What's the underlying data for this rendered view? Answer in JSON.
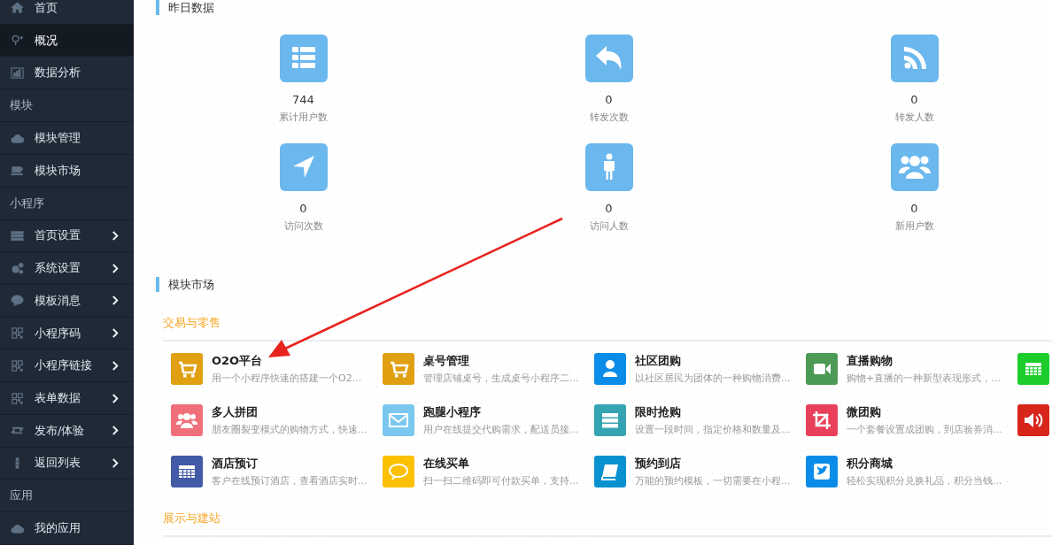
{
  "sidebar": {
    "items": [
      {
        "kind": "item",
        "label": "首页",
        "selected": false,
        "has_submenu": false
      },
      {
        "kind": "item",
        "label": "概况",
        "selected": true,
        "has_submenu": false
      },
      {
        "kind": "item",
        "label": "数据分析",
        "selected": false,
        "has_submenu": false
      },
      {
        "kind": "header",
        "label": "模块"
      },
      {
        "kind": "item",
        "label": "模块管理",
        "selected": false,
        "has_submenu": false
      },
      {
        "kind": "item",
        "label": "模块市场",
        "selected": false,
        "has_submenu": false
      },
      {
        "kind": "header",
        "label": "小程序"
      },
      {
        "kind": "item",
        "label": "首页设置",
        "selected": false,
        "has_submenu": true
      },
      {
        "kind": "item",
        "label": "系统设置",
        "selected": false,
        "has_submenu": true
      },
      {
        "kind": "item",
        "label": "模板消息",
        "selected": false,
        "has_submenu": true
      },
      {
        "kind": "item",
        "label": "小程序码",
        "selected": false,
        "has_submenu": true
      },
      {
        "kind": "item",
        "label": "小程序链接",
        "selected": false,
        "has_submenu": true
      },
      {
        "kind": "item",
        "label": "表单数据",
        "selected": false,
        "has_submenu": true
      },
      {
        "kind": "item",
        "label": "发布/体验",
        "selected": false,
        "has_submenu": true
      },
      {
        "kind": "item",
        "label": "返回列表",
        "selected": false,
        "has_submenu": true
      },
      {
        "kind": "header",
        "label": "应用"
      },
      {
        "kind": "item",
        "label": "我的应用",
        "selected": false,
        "has_submenu": false
      }
    ]
  },
  "stats_section": {
    "title": "昨日数据",
    "stats": [
      {
        "value": "744",
        "label": "累计用户数"
      },
      {
        "value": "0",
        "label": "转发次数"
      },
      {
        "value": "0",
        "label": "转发人数"
      },
      {
        "value": "0",
        "label": "访问次数"
      },
      {
        "value": "0",
        "label": "访问人数"
      },
      {
        "value": "0",
        "label": "新用户数"
      }
    ]
  },
  "market_section": {
    "title": "模块市场",
    "categories": [
      {
        "title": "交易与零售",
        "modules": [
          {
            "name": "O2O平台",
            "description": "用一个小程序快速的搭建一个O2...",
            "color": "#e0a012"
          },
          {
            "name": "桌号管理",
            "description": "管理店铺桌号，生成桌号小程序二...",
            "color": "#e0a012"
          },
          {
            "name": "社区团购",
            "description": "以社区居民为团体的一种购物消费...",
            "color": "#0a8ce8"
          },
          {
            "name": "直播购物",
            "description": "购物+直播的一种新型表现形式，...",
            "color": "#4c9a55"
          },
          {
            "color": "#1ccd2b"
          },
          {
            "name": "多人拼团",
            "description": "朋友圈裂变模式的购物方式，快速...",
            "color": "#f0707a"
          },
          {
            "name": "跑腿小程序",
            "description": "用户在线提交代购需求，配送员接...",
            "color": "#7ac8ef"
          },
          {
            "name": "限时抢购",
            "description": "设置一段时间，指定价格和数量及...",
            "color": "#35a4b2"
          },
          {
            "name": "微团购",
            "description": "一个套餐设置成团购，到店验券消...",
            "color": "#e8405a"
          },
          {
            "color": "#d8251c"
          },
          {
            "name": "酒店预订",
            "description": "客户在线预订酒店，查看酒店实时...",
            "color": "#435aa6"
          },
          {
            "name": "在线买单",
            "description": "扫一扫二维码即可付款买单，支持...",
            "color": "#fbc000"
          },
          {
            "name": "预约到店",
            "description": "万能的预约模板，一切需要在小程...",
            "color": "#0a92d0"
          },
          {
            "name": "积分商城",
            "description": "轻松实现积分兑换礼品，积分当钱...",
            "color": "#0a8ce8"
          }
        ]
      },
      {
        "title": "展示与建站"
      }
    ]
  }
}
